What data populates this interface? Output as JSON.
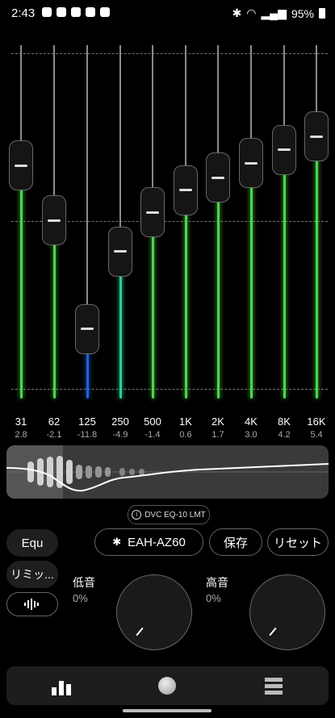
{
  "status": {
    "time": "2:43",
    "battery": "95%"
  },
  "eq": {
    "bands": [
      {
        "freq": "31",
        "gain": "2.8",
        "value": 2.8
      },
      {
        "freq": "62",
        "gain": "-2.1",
        "value": -2.1
      },
      {
        "freq": "125",
        "gain": "-11.8",
        "value": -11.8
      },
      {
        "freq": "250",
        "gain": "-4.9",
        "value": -4.9
      },
      {
        "freq": "500",
        "gain": "-1.4",
        "value": -1.4
      },
      {
        "freq": "1K",
        "gain": "0.6",
        "value": 0.6
      },
      {
        "freq": "2K",
        "gain": "1.7",
        "value": 1.7
      },
      {
        "freq": "4K",
        "gain": "3.0",
        "value": 3.0
      },
      {
        "freq": "8K",
        "gain": "4.2",
        "value": 4.2
      },
      {
        "freq": "16K",
        "gain": "5.4",
        "value": 5.4
      }
    ],
    "range": [
      -15,
      15
    ]
  },
  "dvc_label": "DVC EQ-10 LMT",
  "controls": {
    "preset_label": "Equ",
    "limiter_label": "リミッ...",
    "device_label": "EAH-AZ60",
    "save_label": "保存",
    "reset_label": "リセット"
  },
  "bass": {
    "label": "低音",
    "value": "0%"
  },
  "treble": {
    "label": "高音",
    "value": "0%"
  },
  "colors": {
    "eq_green": "#4cd64c",
    "eq_teal": "#2ccf9a",
    "eq_blue": "#1e63d8",
    "panel": "#3a3a3a"
  }
}
